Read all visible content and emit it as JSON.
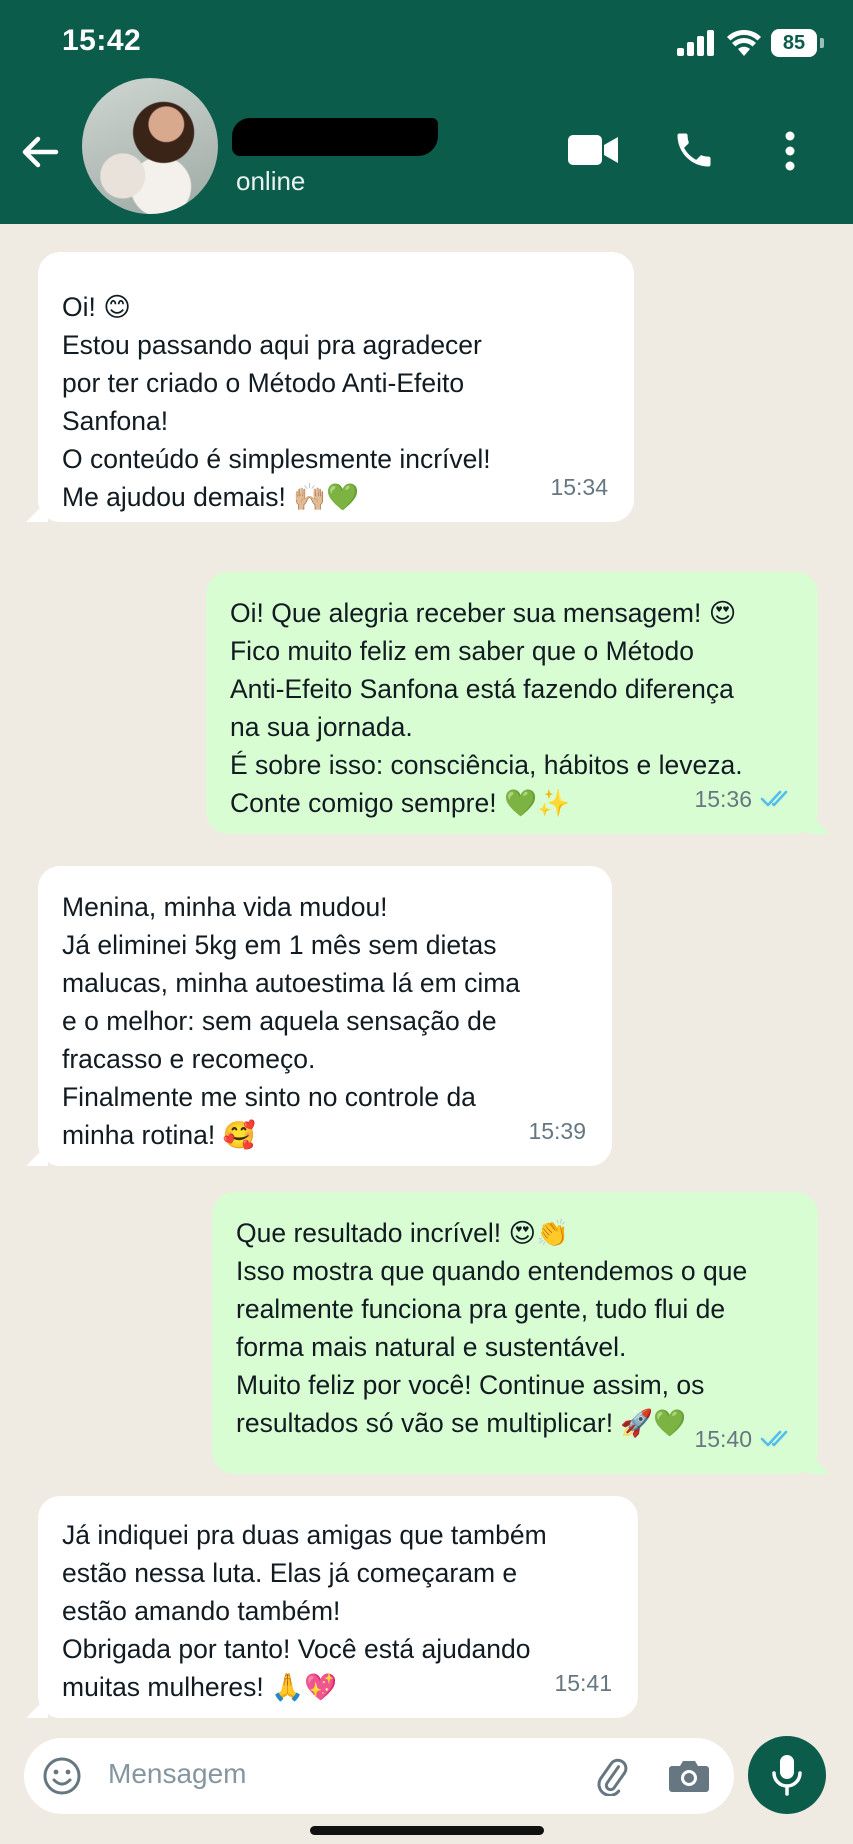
{
  "status_bar": {
    "time": "15:42",
    "battery": "85"
  },
  "header": {
    "status": "online"
  },
  "messages": [
    {
      "direction": "in",
      "text": "Oi! 😊\nEstou passando aqui pra agradecer\npor ter criado o Método Anti-Efeito\nSanfona!\nO conteúdo é simplesmente incrível!\nMe ajudou demais! 🙌🏼💚",
      "time": "15:34"
    },
    {
      "direction": "out",
      "text": "Oi! Que alegria receber sua mensagem! 😍\nFico muito feliz em saber que o Método\nAnti-Efeito Sanfona está fazendo diferença\nna sua jornada.\nÉ sobre isso: consciência, hábitos e leveza.\nConte comigo sempre! 💚✨",
      "time": "15:36",
      "read": true
    },
    {
      "direction": "in",
      "text": "Menina, minha vida mudou!\nJá eliminei 5kg em 1 mês sem dietas\nmalucas, minha autoestima lá em cima\ne o melhor: sem aquela sensação de\nfracasso e recomeço.\nFinalmente me sinto no controle da\nminha rotina! 🥰",
      "time": "15:39"
    },
    {
      "direction": "out",
      "text": "Que resultado incrível! 😍👏\nIsso mostra que quando entendemos o que\nrealmente funciona pra gente, tudo flui de\nforma mais natural e sustentável.\nMuito feliz por você! Continue assim, os\nresultados só vão se multiplicar! 🚀💚",
      "time": "15:40",
      "read": true
    },
    {
      "direction": "in",
      "text": "Já indiquei pra duas amigas que também\nestão nessa luta. Elas já começaram e\nestão amando também!\nObrigada por tanto! Você está ajudando\nmuitas mulheres! 🙏💖",
      "time": "15:41"
    }
  ],
  "composer": {
    "placeholder": "Mensagem"
  },
  "colors": {
    "header": "#0b5c4b",
    "outgoing_bubble": "#d9fdd3",
    "incoming_bubble": "#ffffff",
    "background": "#efeae2",
    "read_ticks": "#53bdeb"
  },
  "icons": [
    "back-arrow-icon",
    "video-call-icon",
    "phone-icon",
    "more-vertical-icon",
    "emoji-icon",
    "attach-icon",
    "camera-icon",
    "mic-icon",
    "signal-icon",
    "wifi-icon",
    "battery-icon"
  ]
}
